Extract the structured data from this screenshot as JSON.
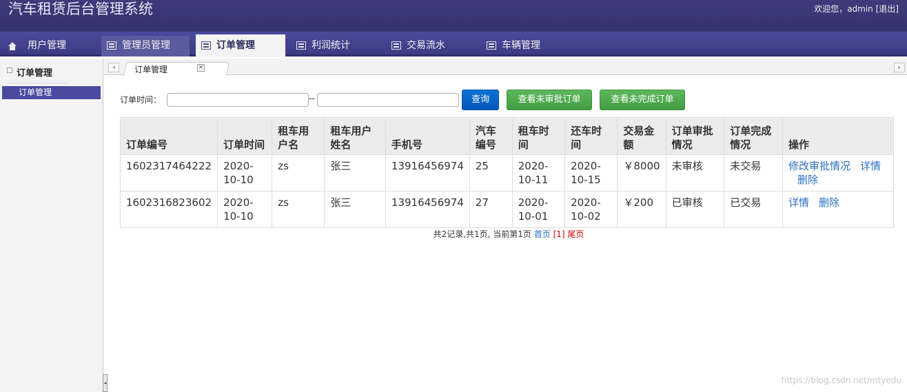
{
  "header": {
    "title": "汽车租赁后台管理系统",
    "welcome": "欢迎您，admin",
    "logout": "[退出]"
  },
  "nav": {
    "items": [
      {
        "label": "用户管理",
        "icon": "home-icon"
      },
      {
        "label": "管理员管理",
        "icon": "list-icon"
      },
      {
        "label": "订单管理",
        "icon": "list-icon",
        "active": true
      },
      {
        "label": "利润统计",
        "icon": "list-icon"
      },
      {
        "label": "交易流水",
        "icon": "list-icon"
      },
      {
        "label": "车辆管理",
        "icon": "list-icon"
      }
    ]
  },
  "sidebar": {
    "title": "订单管理",
    "items": [
      {
        "label": "订单管理"
      }
    ]
  },
  "tabs": [
    {
      "label": "订单管理",
      "close": "×"
    }
  ],
  "search": {
    "label": "订单时间：",
    "separator": "--",
    "start_value": "",
    "end_value": "",
    "query_btn": "查询",
    "unapproved_btn": "查看未审批订单",
    "unfinished_btn": "查看未完成订单"
  },
  "table": {
    "headers": [
      "订单编号",
      "订单时间",
      "租车用户名",
      "租车用户姓名",
      "手机号",
      "汽车编号",
      "租车时间",
      "还车时间",
      "交易金额",
      "订单审批情况",
      "订单完成情况",
      "操作"
    ],
    "rows": [
      {
        "order_no": "1602317464222",
        "order_time": "2020-10-10",
        "username": "zs",
        "name": "张三",
        "phone": "13916456974",
        "car_no": "25",
        "rent_time": "2020-10-11",
        "return_time": "2020-10-15",
        "amount": "￥8000",
        "approval": "未审核",
        "completion": "未交易",
        "actions": [
          "修改审批情况",
          "详情",
          "删除"
        ]
      },
      {
        "order_no": "1602316823602",
        "order_time": "2020-10-10",
        "username": "zs",
        "name": "张三",
        "phone": "13916456974",
        "car_no": "27",
        "rent_time": "2020-10-01",
        "return_time": "2020-10-02",
        "amount": "￥200",
        "approval": "已审核",
        "completion": "已交易",
        "actions": [
          "详情",
          "删除"
        ]
      }
    ]
  },
  "pager": {
    "summary": "共2记录,共1页, 当前第1页",
    "first": "首页",
    "current": "[1]",
    "last": "尾页"
  },
  "watermark": "https://blog.csdn.net/mtyedu",
  "colors": {
    "header_bg": "#3d3b7a",
    "nav_bg": "#4a4a9c",
    "sidebar_active": "#4a4aa0",
    "primary_btn": "#0a74d6",
    "success_btn": "#5cb85c",
    "link": "#2a6fc0"
  }
}
